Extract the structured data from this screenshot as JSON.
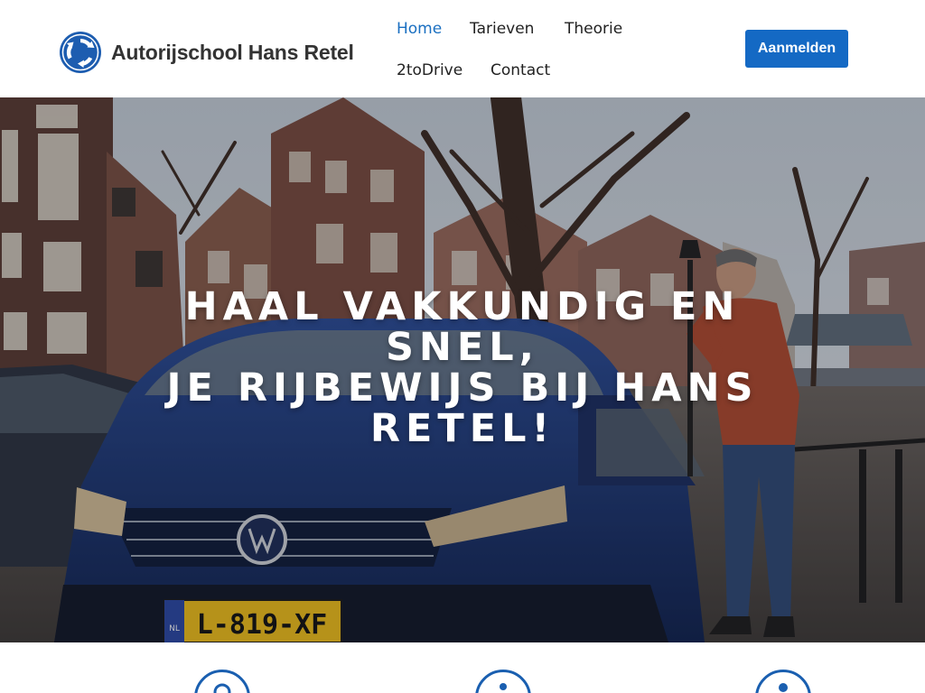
{
  "brand": {
    "name": "Autorijschool Hans Retel",
    "accent": "#1469c4",
    "logo_icon": "roundabout-icon"
  },
  "nav": {
    "items": [
      {
        "label": "Home",
        "active": true
      },
      {
        "label": "Tarieven",
        "active": false
      },
      {
        "label": "Theorie",
        "active": false
      },
      {
        "label": "2toDrive",
        "active": false
      },
      {
        "label": "Contact",
        "active": false
      }
    ],
    "active_color": "#1a6fc1"
  },
  "cta": {
    "label": "Aanmelden"
  },
  "hero": {
    "line1": "HAAL VAKKUNDIG EN SNEL,",
    "line2": "JE RIJBEWIJS BIJ HANS RETEL!",
    "plate": "L-819-XF",
    "plate_country": "NL"
  },
  "features": {
    "icons": [
      "user-icon",
      "info-icon",
      "car-icon"
    ],
    "icon_color": "#1a5fb0"
  }
}
